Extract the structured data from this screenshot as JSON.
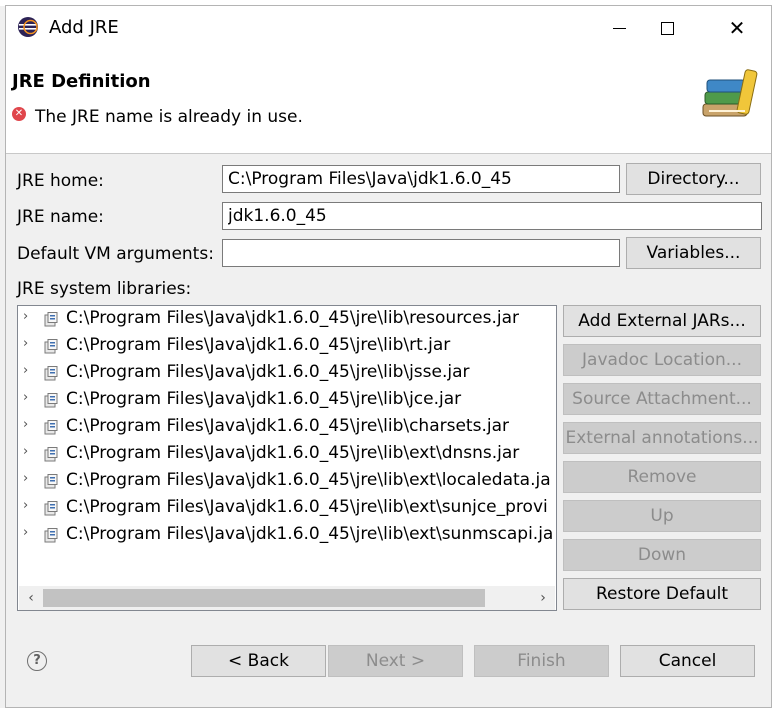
{
  "window": {
    "title": "Add JRE",
    "controls": {
      "minimize": "minimize",
      "maximize": "maximize",
      "close": "✕"
    }
  },
  "header": {
    "title": "JRE Definition",
    "error_message": "The JRE name is already in use."
  },
  "form": {
    "jre_home_label": "JRE home:",
    "jre_home_value": "C:\\Program Files\\Java\\jdk1.6.0_45",
    "directory_button": "Directory...",
    "jre_name_label": "JRE name:",
    "jre_name_value": "jdk1.6.0_45",
    "vm_args_label": "Default VM arguments:",
    "vm_args_value": "",
    "variables_button": "Variables...",
    "libraries_label": "JRE system libraries:"
  },
  "libraries": [
    "C:\\Program Files\\Java\\jdk1.6.0_45\\jre\\lib\\resources.jar",
    "C:\\Program Files\\Java\\jdk1.6.0_45\\jre\\lib\\rt.jar",
    "C:\\Program Files\\Java\\jdk1.6.0_45\\jre\\lib\\jsse.jar",
    "C:\\Program Files\\Java\\jdk1.6.0_45\\jre\\lib\\jce.jar",
    "C:\\Program Files\\Java\\jdk1.6.0_45\\jre\\lib\\charsets.jar",
    "C:\\Program Files\\Java\\jdk1.6.0_45\\jre\\lib\\ext\\dnsns.jar",
    "C:\\Program Files\\Java\\jdk1.6.0_45\\jre\\lib\\ext\\localedata.ja",
    "C:\\Program Files\\Java\\jdk1.6.0_45\\jre\\lib\\ext\\sunjce_provi",
    "C:\\Program Files\\Java\\jdk1.6.0_45\\jre\\lib\\ext\\sunmscapi.ja"
  ],
  "library_buttons": {
    "add_external_jars": "Add External JARs...",
    "javadoc_location": "Javadoc Location...",
    "source_attachment": "Source Attachment...",
    "external_annotations": "External annotations...",
    "remove": "Remove",
    "up": "Up",
    "down": "Down",
    "restore_default": "Restore Default"
  },
  "footer": {
    "back": "< Back",
    "next": "Next >",
    "finish": "Finish",
    "cancel": "Cancel",
    "help": "?"
  },
  "colors": {
    "dialog_bg": "#f0f0f0",
    "header_bg": "#ffffff",
    "error_red": "#e0464c",
    "disabled_text": "#8c8c8c"
  },
  "icons": {
    "app": "eclipse-icon",
    "header": "books-icon",
    "error": "error-icon",
    "library": "jar-icon",
    "help": "help-icon"
  }
}
